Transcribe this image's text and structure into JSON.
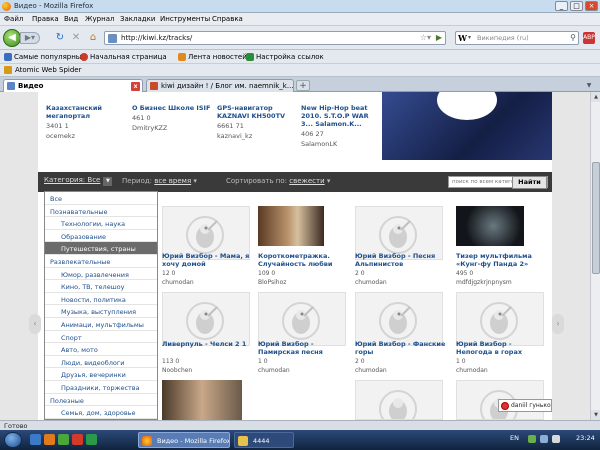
{
  "window": {
    "title": "Видео - Mozilla Firefox"
  },
  "menu": [
    "Файл",
    "Правка",
    "Вид",
    "Журнал",
    "Закладки",
    "Инструменты",
    "Справка"
  ],
  "nav": {
    "url": "http://kiwi.kz/tracks/",
    "search_placeholder": "Википедия (ru)",
    "search_engine": "W"
  },
  "bookmarks": [
    {
      "label": "Самые популярные",
      "color": "#3b6dc1"
    },
    {
      "label": "Начальная страница",
      "color": "#c83a2a"
    },
    {
      "label": "Лента новостей",
      "color": "#e08a1e"
    },
    {
      "label": "Настройка ссылок",
      "color": "#2b8c3a"
    }
  ],
  "bookmarks2": {
    "label": "Atomic Web Spider"
  },
  "tabs": [
    {
      "label": "Видео",
      "active": true
    },
    {
      "label": "kiwi дизайн ! / Блог им. naemnik_k...",
      "active": false
    }
  ],
  "top_cards": [
    {
      "title": "Казахстанский мегапортал",
      "stats": "3401  1",
      "user": "ocemekz"
    },
    {
      "title": "О Бизнес Школе ISIF",
      "stats": "461  0",
      "user": "DmitryKZZ"
    },
    {
      "title": "GPS-навигатор KAZNAVI KH500TV",
      "stats": "6661  71",
      "user": "kaznavi_kz"
    },
    {
      "title": "New Hip-Hop beat 2010. S.T.O.P WAR 3... Salamon.K...",
      "stats": "406  27",
      "user": "SalamonLK"
    }
  ],
  "filter": {
    "category_label": "Категория:",
    "category_value": "Все",
    "period_label": "Период:",
    "period_value": "все время",
    "sort_label": "Сортировать по:",
    "sort_value": "свежести",
    "search_placeholder": "поиск по всем категориям ин",
    "find_button": "Найти"
  },
  "dropdown": [
    {
      "label": "Все",
      "level": 0,
      "highlight": false
    },
    {
      "label": "Познавательные",
      "level": 0,
      "highlight": false
    },
    {
      "label": "Технологии, наука",
      "level": 1,
      "highlight": false
    },
    {
      "label": "Образование",
      "level": 1,
      "highlight": false
    },
    {
      "label": "Путешествия, страны",
      "level": 1,
      "highlight": true
    },
    {
      "label": "Развлекательные",
      "level": 0,
      "highlight": false
    },
    {
      "label": "Юмор, развлечения",
      "level": 1,
      "highlight": false
    },
    {
      "label": "Кино, ТВ, телешоу",
      "level": 1,
      "highlight": false
    },
    {
      "label": "Новости, политика",
      "level": 1,
      "highlight": false
    },
    {
      "label": "Музыка, выступления",
      "level": 1,
      "highlight": false
    },
    {
      "label": "Анимаци, мультфильмы",
      "level": 1,
      "highlight": false
    },
    {
      "label": "Спорт",
      "level": 1,
      "highlight": false
    },
    {
      "label": "Авто, мото",
      "level": 1,
      "highlight": false
    },
    {
      "label": "Люди, видеоблоги",
      "level": 1,
      "highlight": false
    },
    {
      "label": "Друзья, вечеринки",
      "level": 1,
      "highlight": false
    },
    {
      "label": "Праздники, торжества",
      "level": 1,
      "highlight": false
    },
    {
      "label": "Полезные",
      "level": 0,
      "highlight": false
    },
    {
      "label": "Семья, дом, здоровье",
      "level": 1,
      "highlight": false
    }
  ],
  "videos_row1": [
    {
      "title": "Юрий Визбор - Мама, я хочу домой",
      "stats": "12  0",
      "user": "chumodan"
    },
    {
      "title": "Короткометражка. Случайность любви",
      "stats": "109  0",
      "user": "BloPsihoz"
    },
    {
      "title": "Юрий Визбор - Песня Альпинистов",
      "stats": "2  0",
      "user": "chumodan"
    },
    {
      "title": "Тизер мультфильма «Кунг-фу Панда 2»",
      "stats": "495  0",
      "user": "mdfdjgzkrjnpnysm"
    }
  ],
  "videos_row2": [
    {
      "title": "Ливерпуль - Челси 2 1",
      "stats": "113  0",
      "user": "Noobchen"
    },
    {
      "title": "Юрий Визбор - Памирская песня",
      "stats": "1  0",
      "user": "chumodan"
    },
    {
      "title": "Юрий Визбор - Фанские горы",
      "stats": "2  0",
      "user": "chumodan"
    },
    {
      "title": "Юрий Визбор - Непогода в горах",
      "stats": "1  0",
      "user": "chumodan"
    }
  ],
  "notification": {
    "user": "daniil гунько"
  },
  "status": "Готово",
  "taskbar": {
    "tasks": [
      {
        "label": "Видео - Mozilla Firefox"
      },
      {
        "label": "4444"
      }
    ],
    "lang": "EN",
    "time": "23:24"
  }
}
